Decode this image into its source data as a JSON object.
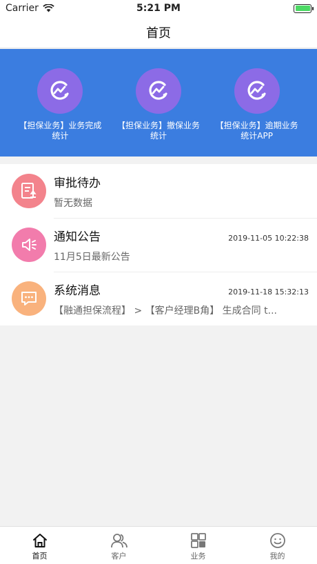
{
  "status_bar": {
    "carrier": "Carrier",
    "time": "5:21 PM"
  },
  "nav": {
    "title": "首页"
  },
  "banner": {
    "color": "#3b7de0",
    "icon_color": "#8c6be6",
    "items": [
      {
        "label": "【担保业务】业务完成统计"
      },
      {
        "label": "【担保业务】撤保业务统计"
      },
      {
        "label": "【担保业务】逾期业务统计APP"
      }
    ]
  },
  "list": {
    "rows": [
      {
        "icon": "document-icon",
        "icon_color": "#f3838c",
        "title": "审批待办",
        "time": "",
        "subtitle": "暂无数据"
      },
      {
        "icon": "megaphone-icon",
        "icon_color": "#f27cac",
        "title": "通知公告",
        "time": "2019-11-05 10:22:38",
        "subtitle": "11月5日最新公告"
      },
      {
        "icon": "message-icon",
        "icon_color": "#f9b27d",
        "title": "系统消息",
        "time": "2019-11-18 15:32:13",
        "subtitle": "【融通担保流程】 > 【客户经理B角】 生成合同 t..."
      }
    ]
  },
  "tabbar": {
    "items": [
      {
        "label": "首页",
        "icon": "home-icon",
        "active": true
      },
      {
        "label": "客户",
        "icon": "people-icon",
        "active": false
      },
      {
        "label": "业务",
        "icon": "grid-icon",
        "active": false
      },
      {
        "label": "我的",
        "icon": "smiley-icon",
        "active": false
      }
    ]
  }
}
